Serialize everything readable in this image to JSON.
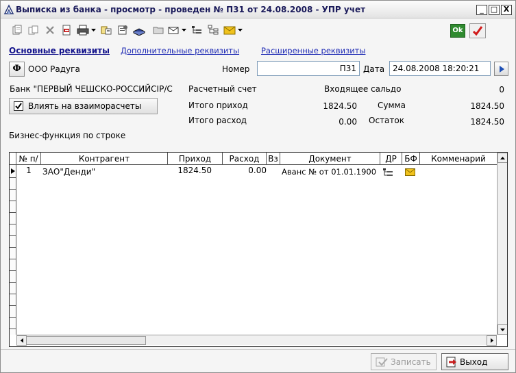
{
  "window": {
    "title": "Выписка из банка  - просмотр - проведен № П31 от 24.08.2008 - УПР учет",
    "controls": {
      "minimize": "_",
      "maximize": "□",
      "close": "X"
    }
  },
  "toolbar": {
    "ok_label": "Ok",
    "icons": [
      "new-copy-icon",
      "copy-icon",
      "delete-icon",
      "post-document-icon",
      "print-icon",
      "move-icon",
      "properties-icon",
      "book-icon",
      "folder-icon",
      "mail-icon",
      "structure-icon",
      "tree-icon",
      "envelope-icon",
      "confirm-icon",
      "cancel-icon"
    ]
  },
  "tabs": [
    {
      "label": "Основные реквизиты"
    },
    {
      "label": "Дополнительные реквизиты"
    },
    {
      "label": "Расширенные реквизиты"
    }
  ],
  "header": {
    "f_button": "Ф",
    "organization": "ООО Радуга",
    "number_label": "Номер",
    "number_value": "П31",
    "date_label": "Дата",
    "date_value": "24.08.2008 18:20:21"
  },
  "summary": {
    "bank_label": "Банк \"ПЕРВЫЙ ЧЕШСКО-РОССИЙСІР/С",
    "account_label": "Расчетный счет",
    "opening_balance_label": "Входящее сальдо",
    "opening_balance_value": "0",
    "influence_label": "Влиять на взаиморасчеты",
    "total_income_label": "Итого приход",
    "total_income_value": "1824.50",
    "sum_label": "Сумма",
    "sum_value": "1824.50",
    "total_expense_label": "Итого расход",
    "total_expense_value": "0.00",
    "remainder_label": "Остаток",
    "remainder_value": "1824.50",
    "business_function_label": "Бизнес-функция по строке"
  },
  "grid": {
    "columns": [
      "№ п/",
      "Контрагент",
      "Приход",
      "Расход",
      "Вз",
      "Документ",
      "ДР",
      "БФ",
      "Комменарий"
    ],
    "rows": [
      {
        "num": "1",
        "counterparty": "ЗАО\"Денди\"",
        "income": "1824.50",
        "expense": "0.00",
        "document": "Аванс №  от 01.01.1900"
      }
    ]
  },
  "footer": {
    "save_label": "Записать",
    "exit_label": "Выход"
  }
}
